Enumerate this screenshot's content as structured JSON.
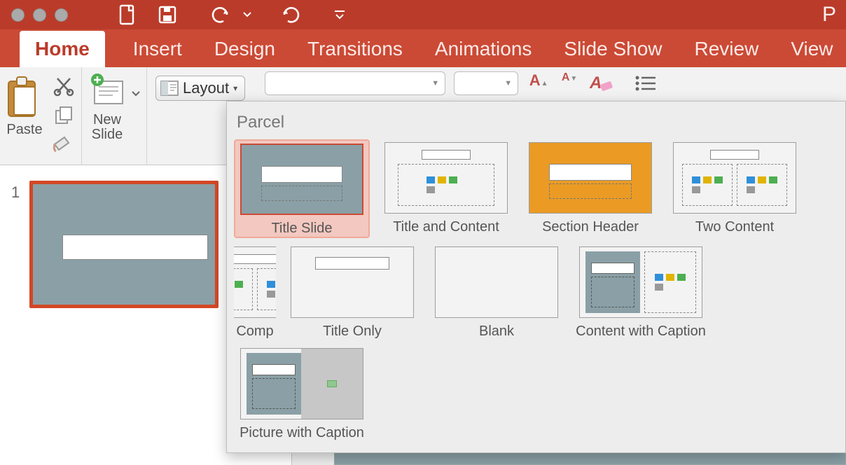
{
  "app_initial": "P",
  "tabs": [
    "Home",
    "Insert",
    "Design",
    "Transitions",
    "Animations",
    "Slide Show",
    "Review",
    "View"
  ],
  "active_tab": "Home",
  "ribbon": {
    "paste_label": "Paste",
    "new_slide_top": "New",
    "new_slide_bottom": "Slide",
    "layout_label": "Layout"
  },
  "slide_panel": {
    "current_slide_number": "1"
  },
  "layout_gallery": {
    "theme_name": "Parcel",
    "layouts": [
      {
        "id": "title-slide",
        "label": "Title Slide",
        "selected": true
      },
      {
        "id": "title-content",
        "label": "Title and Content"
      },
      {
        "id": "section-header",
        "label": "Section Header"
      },
      {
        "id": "two-content",
        "label": "Two Content"
      },
      {
        "id": "comparison",
        "label": "Comp",
        "partial": true
      },
      {
        "id": "title-only",
        "label": "Title Only"
      },
      {
        "id": "blank",
        "label": "Blank"
      },
      {
        "id": "content-caption",
        "label": "Content with Caption"
      },
      {
        "id": "picture-caption",
        "label": "Picture with Caption"
      }
    ]
  }
}
